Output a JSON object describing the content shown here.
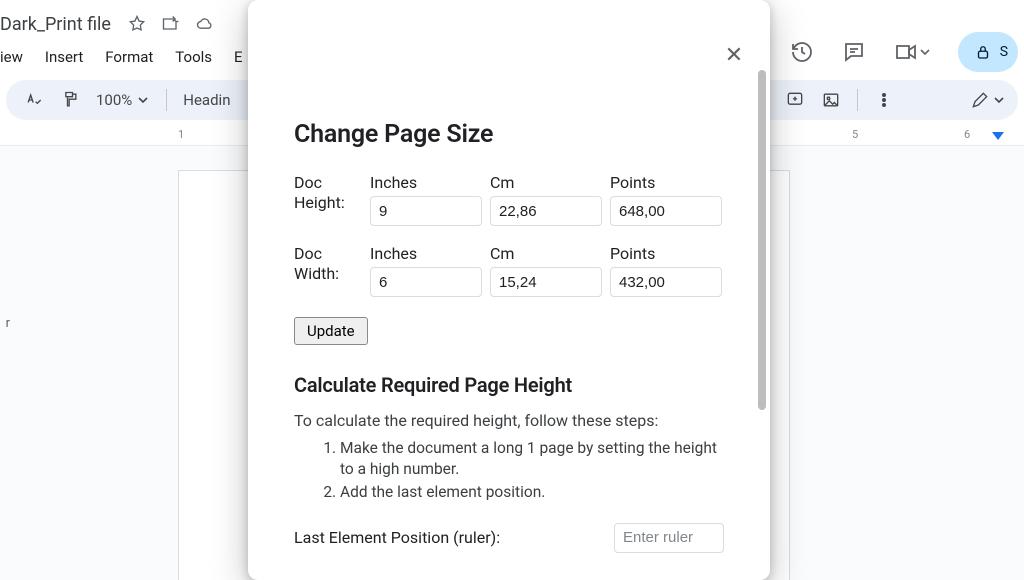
{
  "header": {
    "doc_title": "Dark_Print file",
    "share_label": "S"
  },
  "menu": {
    "items": [
      "iew",
      "Insert",
      "Format",
      "Tools",
      "E"
    ]
  },
  "toolbar": {
    "zoom": "100%",
    "style": "Headin"
  },
  "ruler": {
    "marks": {
      "m1": "1",
      "m5": "5",
      "m6": "6"
    }
  },
  "left_panel": {
    "char": "r"
  },
  "dialog": {
    "title": "Change Page Size",
    "height_label": "Doc Height:",
    "width_label": "Doc Width:",
    "unit_inches": "Inches",
    "unit_cm": "Cm",
    "unit_points": "Points",
    "height": {
      "inches": "9",
      "cm": "22,86",
      "points": "648,00"
    },
    "width": {
      "inches": "6",
      "cm": "15,24",
      "points": "432,00"
    },
    "update_label": "Update",
    "calc_title": "Calculate Required Page Height",
    "calc_desc": "To calculate the required height, follow these steps:",
    "calc_steps": {
      "s1": "Make the document a long 1 page by setting the height to a high number.",
      "s2": "Add the last element position."
    },
    "last_label": "Last Element Position (ruler):",
    "last_placeholder": "Enter ruler"
  }
}
